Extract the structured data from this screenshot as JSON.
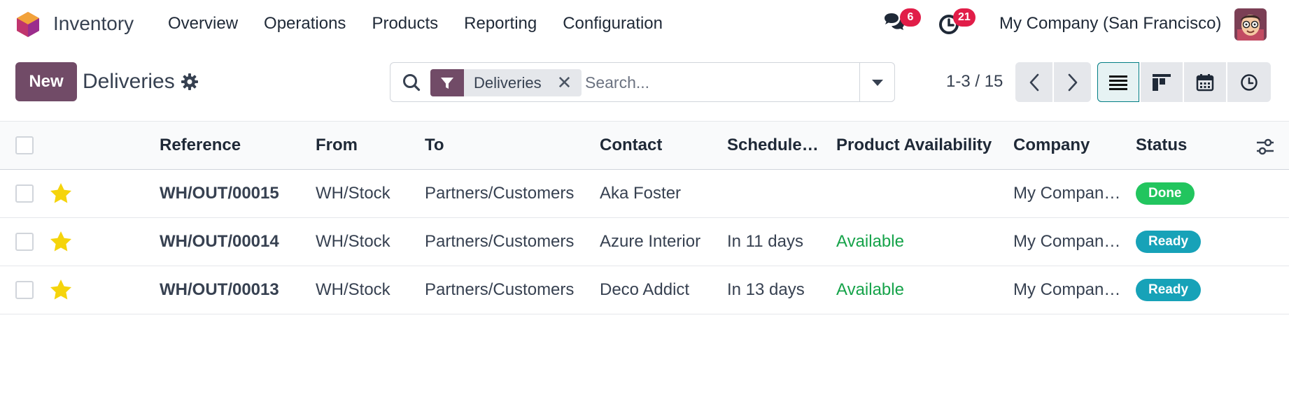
{
  "app": {
    "name": "Inventory",
    "menu": [
      "Overview",
      "Operations",
      "Products",
      "Reporting",
      "Configuration"
    ],
    "messages_count": "6",
    "activities_count": "21",
    "company": "My Company (San Francisco)"
  },
  "control_panel": {
    "new_label": "New",
    "title": "Deliveries",
    "facet_label": "Deliveries",
    "facet_remove": "✕",
    "search_placeholder": "Search...",
    "pager": "1-3 / 15"
  },
  "table": {
    "columns": [
      "Reference",
      "From",
      "To",
      "Contact",
      "Schedule…",
      "Product Availability",
      "Company",
      "Status"
    ],
    "rows": [
      {
        "reference": "WH/OUT/00015",
        "from": "WH/Stock",
        "to": "Partners/Customers",
        "contact": "Aka Foster",
        "scheduled": "",
        "availability": "",
        "company": "My Compan…",
        "status": "Done"
      },
      {
        "reference": "WH/OUT/00014",
        "from": "WH/Stock",
        "to": "Partners/Customers",
        "contact": "Azure Interior",
        "scheduled": "In 11 days",
        "availability": "Available",
        "company": "My Compan…",
        "status": "Ready"
      },
      {
        "reference": "WH/OUT/00013",
        "from": "WH/Stock",
        "to": "Partners/Customers",
        "contact": "Deco Addict",
        "scheduled": "In 13 days",
        "availability": "Available",
        "company": "My Compan…",
        "status": "Ready"
      }
    ]
  },
  "colors": {
    "brand": "#714b67",
    "status_done": "#22c55e",
    "status_ready": "#17a2b8",
    "available": "#16a34a",
    "badge": "#e11d48",
    "star": "#f5d40c"
  }
}
